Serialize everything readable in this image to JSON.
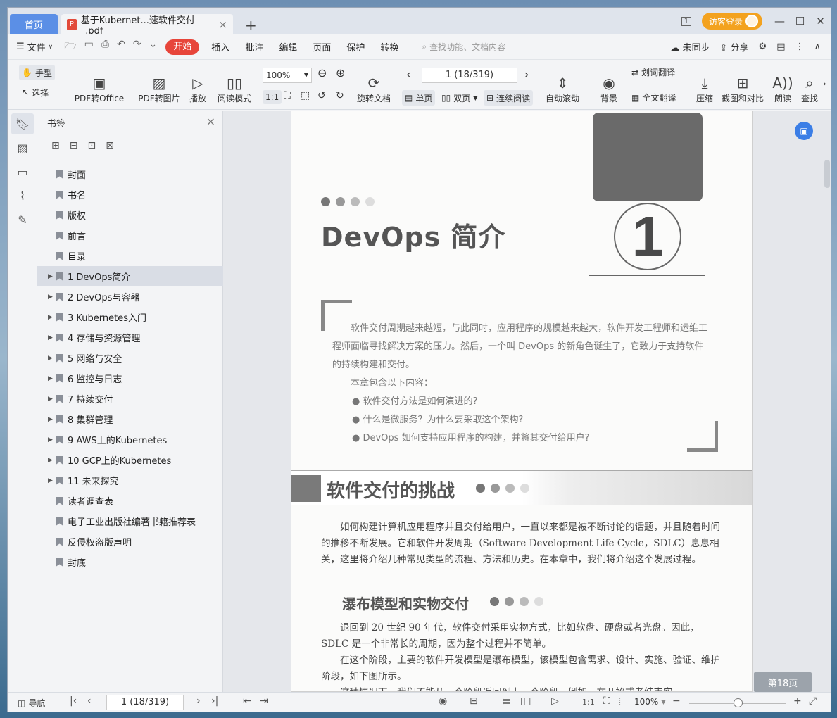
{
  "titlebar": {
    "home_tab": "首页",
    "doc_tab": "基于Kubernet...速软件交付_.pdf",
    "new_tab": "+",
    "page_count_icon": "1",
    "login": "访客登录"
  },
  "menubar": {
    "file": "文件",
    "items": [
      "开始",
      "插入",
      "批注",
      "编辑",
      "页面",
      "保护",
      "转换"
    ],
    "search_placeholder": "查找功能、文档内容",
    "sync": "未同步",
    "share": "分享"
  },
  "toolbar": {
    "hand": "手型",
    "select": "选择",
    "pdf_to_office": "PDF转Office",
    "pdf_to_image": "PDF转图片",
    "play": "播放",
    "read_mode": "阅读模式",
    "zoom": "100%",
    "page_indicator": "1 (18/319)",
    "rotate": "旋转文档",
    "single_page": "单页",
    "double_page": "双页",
    "continuous": "连续阅读",
    "auto_scroll": "自动滚动",
    "background": "背景",
    "word_translate": "划词翻译",
    "full_translate": "全文翻译",
    "compress": "压缩",
    "screenshot_compare": "截图和对比",
    "read_aloud": "朗读",
    "find": "查找"
  },
  "sidebar": {
    "title": "书签",
    "bookmarks": [
      {
        "label": "封面",
        "expandable": false
      },
      {
        "label": "书名",
        "expandable": false
      },
      {
        "label": "版权",
        "expandable": false
      },
      {
        "label": "前言",
        "expandable": false
      },
      {
        "label": "目录",
        "expandable": false
      },
      {
        "label": "1  DevOps简介",
        "expandable": true,
        "active": true
      },
      {
        "label": "2  DevOps与容器",
        "expandable": true
      },
      {
        "label": "3  Kubernetes入门",
        "expandable": true
      },
      {
        "label": "4  存储与资源管理",
        "expandable": true
      },
      {
        "label": "5  网络与安全",
        "expandable": true
      },
      {
        "label": "6  监控与日志",
        "expandable": true
      },
      {
        "label": "7  持续交付",
        "expandable": true
      },
      {
        "label": "8  集群管理",
        "expandable": true
      },
      {
        "label": "9  AWS上的Kubernetes",
        "expandable": true
      },
      {
        "label": "10  GCP上的Kubernetes",
        "expandable": true
      },
      {
        "label": "11  未来探究",
        "expandable": true
      },
      {
        "label": "读者调查表",
        "expandable": false
      },
      {
        "label": "电子工业出版社编著书籍推荐表",
        "expandable": false
      },
      {
        "label": "反侵权盗版声明",
        "expandable": false
      },
      {
        "label": "封底",
        "expandable": false
      }
    ]
  },
  "page": {
    "chapter_number": "1",
    "chapter_title": "DevOps 简介",
    "intro": [
      "软件交付周期越来越短，与此同时，应用程序的规模越来越大，软件开发工程师和运维工程师面临寻找解决方案的压力。然后，一个叫 DevOps 的新角色诞生了，它致力于支持软件的持续构建和交付。",
      "本章包含以下内容："
    ],
    "bullets": [
      "● 软件交付方法是如何演进的?",
      "● 什么是微服务？为什么要采取这个架构?",
      "● DevOps 如何支持应用程序的构建，并将其交付给用户?"
    ],
    "section_title": "软件交付的挑战",
    "section_para": "如何构建计算机应用程序并且交付给用户，一直以来都是被不断讨论的话题，并且随着时间的推移不断发展。它和软件开发周期（Software Development Life Cycle，SDLC）息息相关，这里将介绍几种常见类型的流程、方法和历史。在本章中，我们将介绍这个发展过程。",
    "subsection_title": "瀑布模型和实物交付",
    "sub_para1": "退回到 20 世纪 90 年代，软件交付采用实物方式，比如软盘、硬盘或者光盘。因此，SDLC 是一个非常长的周期，因为整个过程并不简单。",
    "sub_para2": "在这个阶段，主要的软件开发模型是瀑布模型，该模型包含需求、设计、实施、验证、维护阶段，如下图所示。",
    "sub_para3": "这种情况下，我们不能从一个阶段返回到上一个阶段。例如，在开始或者结束实",
    "page_badge": "第18页"
  },
  "statusbar": {
    "nav": "导航",
    "page": "1 (18/319)",
    "zoom": "100%",
    "zoom_level": 0.5
  },
  "colors": {
    "accent": "#e7453a",
    "home_tab": "#5b8fe6",
    "login": "#f3a21f"
  }
}
